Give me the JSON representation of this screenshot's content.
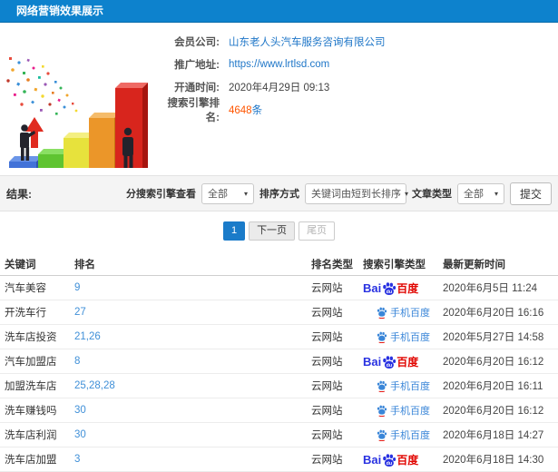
{
  "header": {
    "title": "网络营销效果展示"
  },
  "info": {
    "fields": [
      {
        "label": "会员公司:",
        "value": "山东老人头汽车服务咨询有限公司"
      },
      {
        "label": "推广地址:",
        "value": "https://www.lrtlsd.com"
      },
      {
        "label": "开通时间:",
        "value": "2020年4月29日 09:13"
      },
      {
        "label": "搜索引擎排名:",
        "value": "4648",
        "suffix": "条"
      }
    ]
  },
  "filters": {
    "result_label": "结果:",
    "engine_label": "分搜索引擎查看",
    "engine_value": "全部",
    "sort_label": "排序方式",
    "sort_value": "关键词由短到长排序",
    "article_label": "文章类型",
    "article_value": "全部",
    "submit_label": "提交"
  },
  "pagination": {
    "current": "1",
    "next": "下一页",
    "last": "尾页"
  },
  "table": {
    "columns": [
      "关键词",
      "排名",
      "排名类型",
      "搜索引擎类型",
      "最新更新时间"
    ],
    "engine_labels": {
      "baidu_bai": "Bai",
      "baidu_du": "du",
      "baidu_cn": "百度",
      "mobile": "手机百度"
    },
    "rows": [
      {
        "keyword": "汽车美容",
        "rank": "9",
        "rank_type": "云网站",
        "engine": "baidu",
        "time": "2020年6月5日 11:24"
      },
      {
        "keyword": "开洗车行",
        "rank": "27",
        "rank_type": "云网站",
        "engine": "mobile-baidu",
        "time": "2020年6月20日 16:16"
      },
      {
        "keyword": "洗车店投资",
        "rank": "21,26",
        "rank_type": "云网站",
        "engine": "mobile-baidu",
        "time": "2020年5月27日 14:58"
      },
      {
        "keyword": "汽车加盟店",
        "rank": "8",
        "rank_type": "云网站",
        "engine": "baidu",
        "time": "2020年6月20日 16:12"
      },
      {
        "keyword": "加盟洗车店",
        "rank": "25,28,28",
        "rank_type": "云网站",
        "engine": "mobile-baidu",
        "time": "2020年6月20日 16:11"
      },
      {
        "keyword": "洗车赚钱吗",
        "rank": "30",
        "rank_type": "云网站",
        "engine": "mobile-baidu",
        "time": "2020年6月20日 16:12"
      },
      {
        "keyword": "洗车店利润",
        "rank": "30",
        "rank_type": "云网站",
        "engine": "mobile-baidu",
        "time": "2020年6月18日 14:27"
      },
      {
        "keyword": "洗车店加盟",
        "rank": "3",
        "rank_type": "云网站",
        "engine": "baidu",
        "time": "2020年6月18日 14:30"
      }
    ]
  },
  "colors": {
    "header_bg": "#0d82cd",
    "link_blue": "#2077c8",
    "rank_blue": "#4090d8",
    "highlight_orange": "#ff5500",
    "baidu_blue": "#2932e1",
    "baidu_red": "#e10601",
    "mobile_blue": "#3a86d8",
    "pagination_active": "#1a7bc9"
  }
}
